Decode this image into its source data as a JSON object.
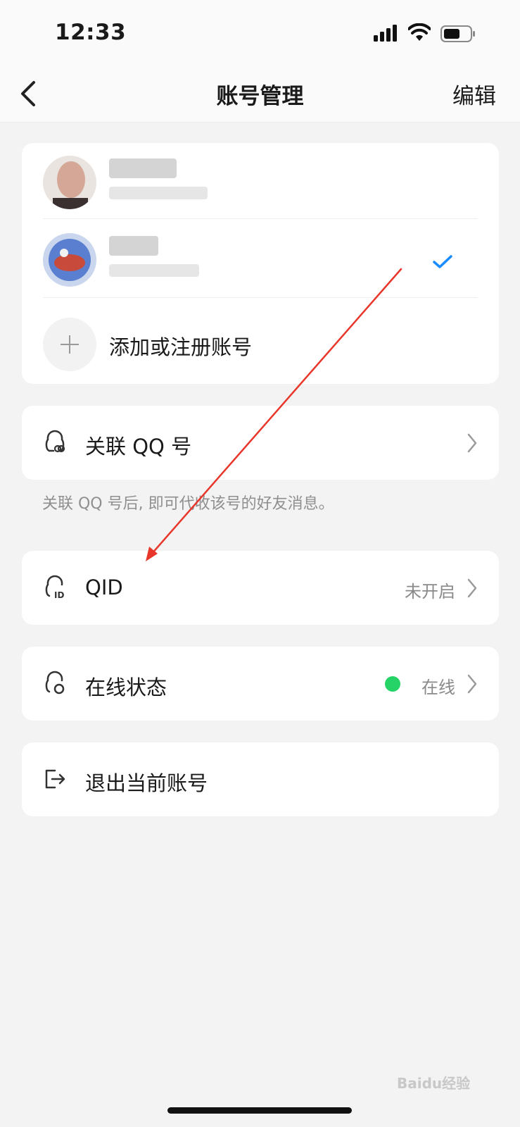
{
  "status_bar": {
    "time": "12:33"
  },
  "header": {
    "title": "账号管理",
    "edit_label": "编辑"
  },
  "accounts": {
    "items": [
      {
        "name": "",
        "number": "",
        "selected": false
      },
      {
        "name": "",
        "number": "",
        "selected": true
      }
    ],
    "add_label": "添加或注册账号"
  },
  "link_qq": {
    "label": "关联 QQ 号",
    "hint": "关联 QQ 号后, 即可代收该号的好友消息。"
  },
  "qid": {
    "label": "QID",
    "value": "未开启"
  },
  "online_status": {
    "label": "在线状态",
    "value": "在线",
    "dot_color": "#25d366"
  },
  "logout": {
    "label": "退出当前账号"
  },
  "watermark": {
    "text": "Baidu经验"
  },
  "colors": {
    "accent": "#1a8cff",
    "annotation_arrow": "#e8362a"
  }
}
